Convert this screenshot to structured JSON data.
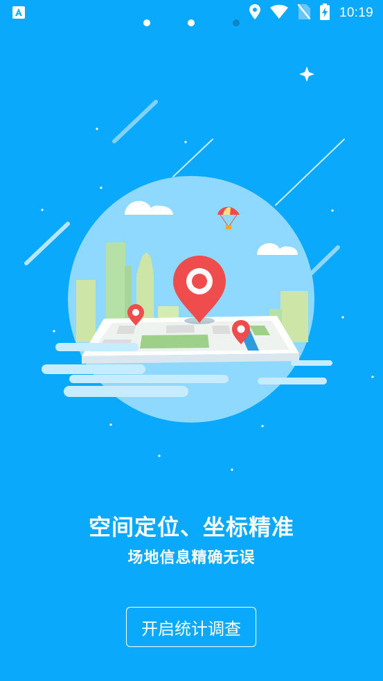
{
  "status_bar": {
    "time": "10:19",
    "icons": [
      "app-notification-icon",
      "location-icon",
      "wifi-icon",
      "no-sim-icon",
      "battery-charging-icon"
    ]
  },
  "pager": {
    "page_count": 3,
    "current_page": 1
  },
  "illustration": {
    "icon": "map-location-illustration"
  },
  "content": {
    "headline": "空间定位、坐标精准",
    "subline": "场地信息精确无误"
  },
  "actions": {
    "start_button_label": "开启统计调查"
  },
  "colors": {
    "background": "#0aa9fb",
    "circle": "#8fd8ff",
    "pin": "#ef4d4d",
    "map_green": "#9fd08a",
    "map_blue": "#2d9bdc"
  }
}
